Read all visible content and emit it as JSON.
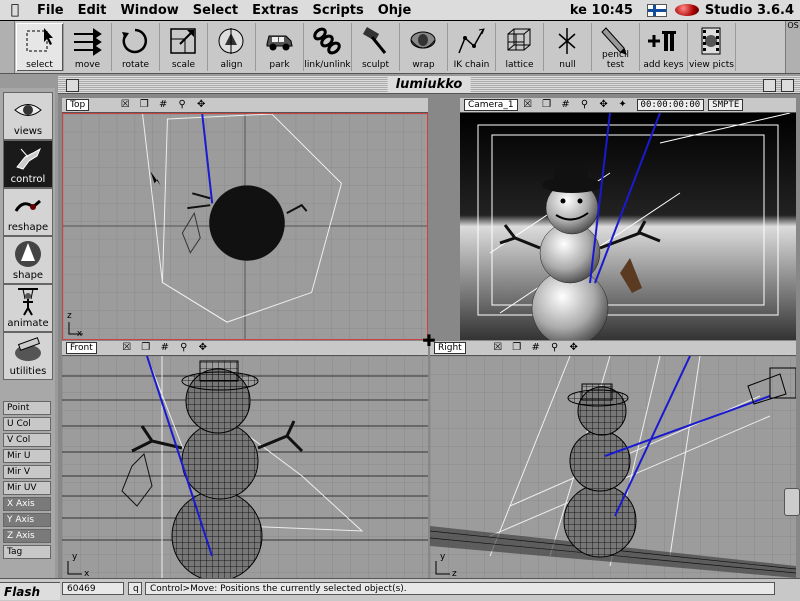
{
  "menubar": {
    "menus": [
      "File",
      "Edit",
      "Window",
      "Select",
      "Extras",
      "Scripts",
      "Ohje"
    ],
    "clock": "ke 10:45",
    "app_name": "Studio 3.6.4"
  },
  "toolbar": {
    "tools": [
      "select",
      "move",
      "rotate",
      "scale",
      "align",
      "park",
      "link/unlink",
      "sculpt",
      "wrap",
      "IK chain",
      "lattice",
      "null",
      "pencil test",
      "add keys",
      "view picts"
    ],
    "selected": "select",
    "close_label": "OS"
  },
  "sidebar": {
    "tools": [
      "views",
      "control",
      "reshape",
      "shape",
      "animate",
      "utilities"
    ],
    "active": "control",
    "modes": [
      "Point",
      "U Col",
      "V Col",
      "Mir U",
      "Mir V",
      "Mir UV",
      "X Axis",
      "Y Axis",
      "Z Axis",
      "Tag"
    ],
    "selected_modes": [
      "X Axis",
      "Y Axis",
      "Z Axis"
    ]
  },
  "window": {
    "title": "lumiukko"
  },
  "viewports": {
    "top": {
      "name": "Top",
      "axis_a": "z",
      "axis_b": "x"
    },
    "camera": {
      "name": "Camera_1",
      "timecode": "00:00:00:00",
      "format": "SMPTE"
    },
    "front": {
      "name": "Front",
      "axis_a": "y",
      "axis_b": "x"
    },
    "right": {
      "name": "Right",
      "axis_a": "y",
      "axis_b": "z"
    }
  },
  "status": {
    "frame": "60469",
    "key": "q",
    "message": "Control>Move: Positions the currently selected object(s).",
    "flash_label": "Flash"
  },
  "colors": {
    "accent_blue": "#1a1ad0",
    "active_border": "#d04040"
  }
}
